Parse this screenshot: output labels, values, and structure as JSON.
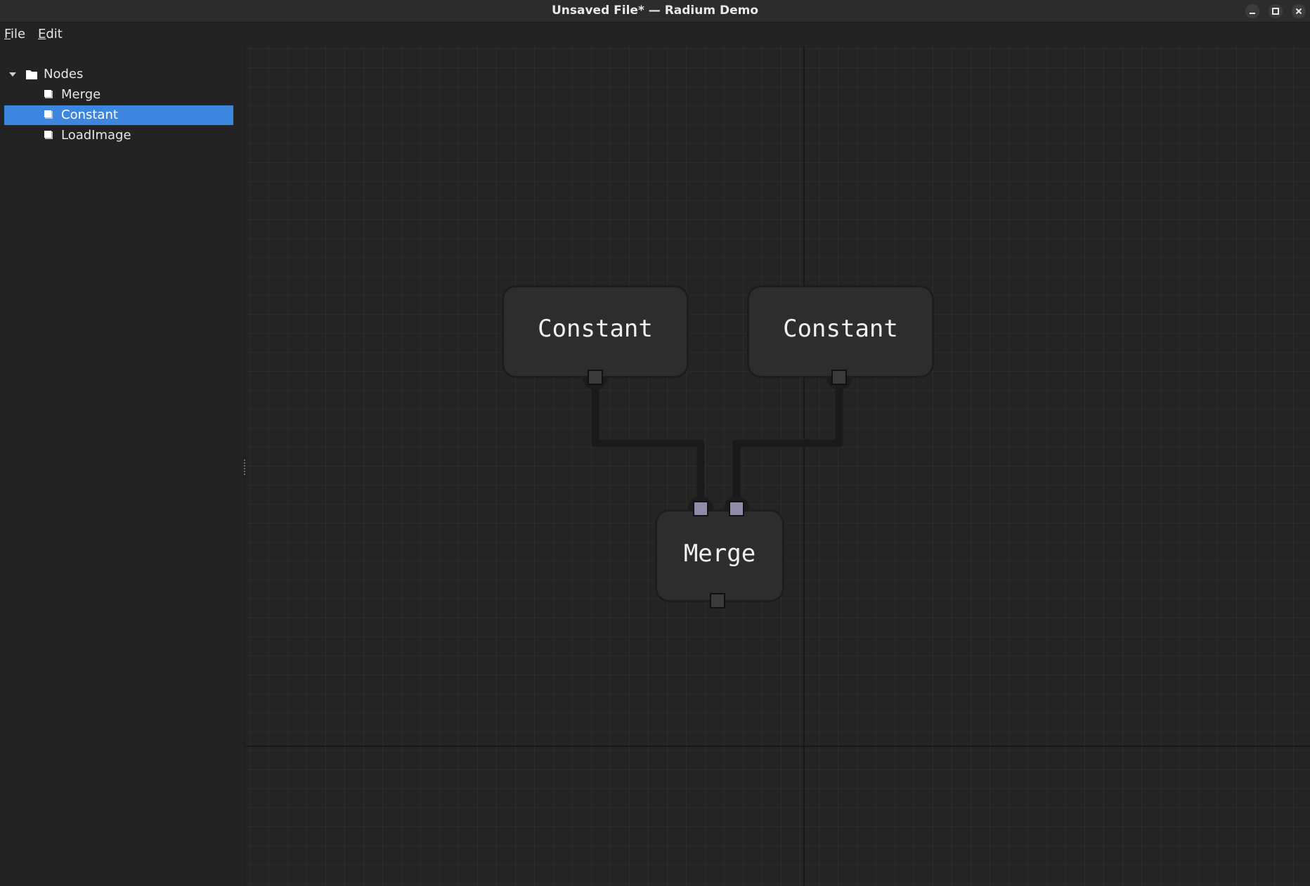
{
  "window": {
    "title": "Unsaved File* — Radium Demo",
    "buttons": {
      "minimize": "minimize-icon",
      "maximize": "maximize-icon",
      "close": "close-icon"
    }
  },
  "menubar": {
    "file": {
      "mnemonic": "F",
      "rest": "ile"
    },
    "edit": {
      "mnemonic": "E",
      "rest": "dit"
    }
  },
  "sidebar": {
    "tree": {
      "root": {
        "label": "Nodes",
        "icon": "folder-icon",
        "expanded": true
      },
      "items": [
        {
          "label": "Merge",
          "icon": "node-icon",
          "selected": false
        },
        {
          "label": "Constant",
          "icon": "node-icon",
          "selected": true
        },
        {
          "label": "LoadImage",
          "icon": "node-icon",
          "selected": false
        }
      ]
    }
  },
  "canvas": {
    "nodes": [
      {
        "label": "Constant",
        "outputs": 1,
        "inputs": 0
      },
      {
        "label": "Constant",
        "outputs": 1,
        "inputs": 0
      },
      {
        "label": "Merge",
        "outputs": 1,
        "inputs": 2
      }
    ],
    "connections": [
      {
        "from": "Constant #1 output",
        "to": "Merge input 1"
      },
      {
        "from": "Constant #2 output",
        "to": "Merge input 2"
      }
    ]
  },
  "colors": {
    "selection": "#3d86e0",
    "canvas_background": "#242424",
    "node_fill": "#2d2d2d",
    "input_port": "#8e8ca8",
    "output_port": "#3a3a3a",
    "wire": "#1a1a1a"
  }
}
